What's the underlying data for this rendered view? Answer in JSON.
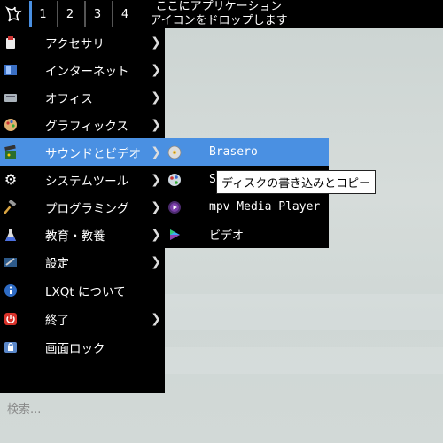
{
  "panel": {
    "workspaces": [
      "1",
      "2",
      "3",
      "4"
    ],
    "active_workspace": "1",
    "task_hint_line1": "ここにアプリケーション",
    "task_hint_line2": "アイコンをドロップします"
  },
  "menu": {
    "items": [
      {
        "label": "アクセサリ",
        "icon": "accessories-icon",
        "submenu": true
      },
      {
        "label": "インターネット",
        "icon": "internet-icon",
        "submenu": true
      },
      {
        "label": "オフィス",
        "icon": "office-icon",
        "submenu": true
      },
      {
        "label": "グラフィックス",
        "icon": "graphics-icon",
        "submenu": true
      },
      {
        "label": "サウンドとビデオ",
        "icon": "multimedia-icon",
        "submenu": true
      },
      {
        "label": "システムツール",
        "icon": "gear-icon",
        "submenu": true
      },
      {
        "label": "プログラミング",
        "icon": "hammer-icon",
        "submenu": true
      },
      {
        "label": "教育・教養",
        "icon": "flask-icon",
        "submenu": true
      },
      {
        "label": "設定",
        "icon": "settings-icon",
        "submenu": true
      },
      {
        "label": "LXQt について",
        "icon": "info-icon",
        "submenu": false
      },
      {
        "label": "終了",
        "icon": "power-icon",
        "submenu": true
      },
      {
        "label": "画面ロック",
        "icon": "lock-icon",
        "submenu": false
      }
    ],
    "highlighted": "サウンドとビデオ",
    "search_placeholder": "検索..."
  },
  "submenu": {
    "items": [
      {
        "label": "Brasero",
        "icon": "disc-icon"
      },
      {
        "label": "S",
        "icon": "palette-icon"
      },
      {
        "label": "mpv Media Player",
        "icon": "mpv-icon"
      },
      {
        "label": "ビデオ",
        "icon": "video-play-icon"
      }
    ],
    "highlighted": "Brasero"
  },
  "tooltip": {
    "text": "ディスクの書き込みとコピー"
  },
  "colors": {
    "highlight": "#4a90e2",
    "menu_bg": "#000000",
    "desktop": "#d3dad8"
  }
}
